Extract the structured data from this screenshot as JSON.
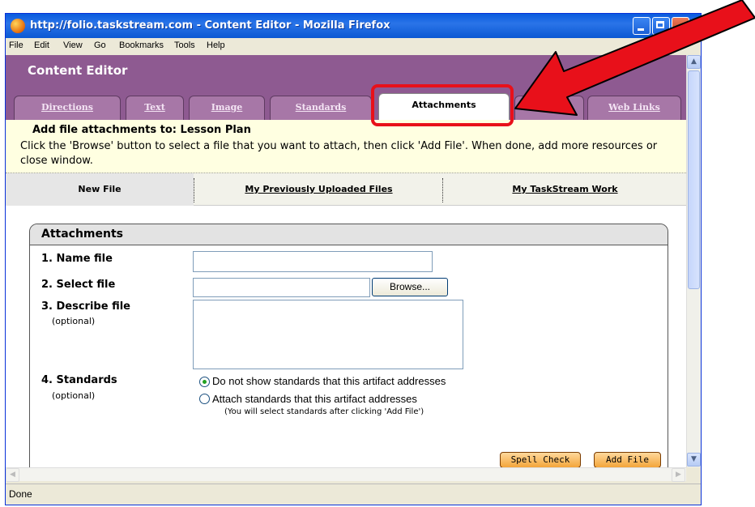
{
  "window": {
    "title": "http://folio.taskstream.com - Content Editor - Mozilla Firefox"
  },
  "menu": [
    "File",
    "Edit",
    "View",
    "Go",
    "Bookmarks",
    "Tools",
    "Help"
  ],
  "header": {
    "title": "Content Editor"
  },
  "tabs": [
    {
      "label": "Directions"
    },
    {
      "label": "Text"
    },
    {
      "label": "Image"
    },
    {
      "label": "Standards"
    },
    {
      "label": "Attachments"
    },
    {
      "label": "Web Links"
    }
  ],
  "instructions": {
    "title": "Add file attachments to: Lesson Plan",
    "text": "Click the 'Browse' button to select a file that you want to attach, then click 'Add File'. When done, add more resources or close window."
  },
  "subtabs": [
    "New File",
    "My Previously Uploaded Files",
    "My TaskStream Work"
  ],
  "panel": {
    "title": "Attachments",
    "name_label": "1. Name file",
    "select_label": "2. Select file",
    "browse": "Browse...",
    "describe_label": "3. Describe file",
    "describe_note": "(optional)",
    "standards_label": "4. Standards",
    "standards_note": "(optional)",
    "option1": "Do not show standards that this artifact addresses",
    "option2": "Attach standards that this artifact addresses",
    "option2_note": "(You will select standards after clicking 'Add File')",
    "spell_check": "Spell Check",
    "add_file": "Add File"
  },
  "status": {
    "text": "Done"
  },
  "colors": {
    "header": "#8e5a91",
    "highlight": "#e8101a",
    "arrow": "#e8101a"
  }
}
